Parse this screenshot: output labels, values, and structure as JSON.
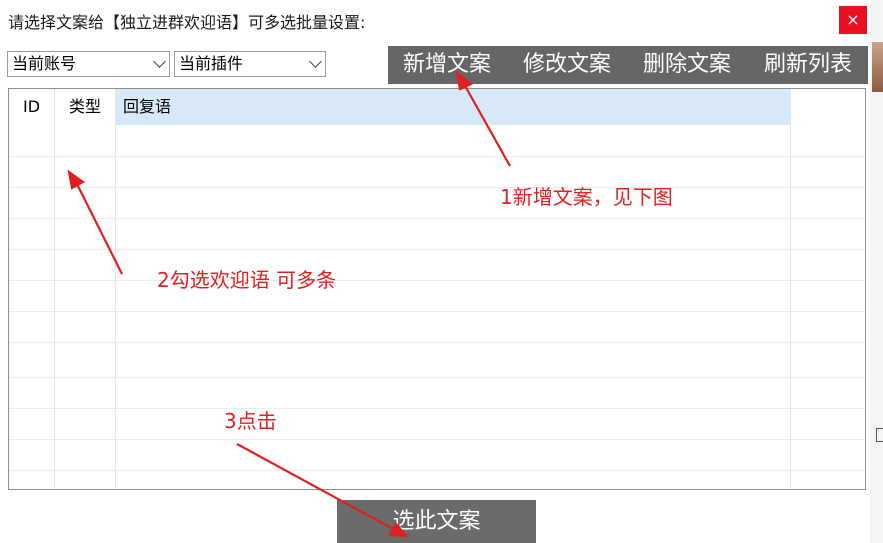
{
  "dialog": {
    "title": "请选择文案给【独立进群欢迎语】可多选批量设置:",
    "close_label": "×"
  },
  "filters": {
    "account": {
      "selected": "当前账号"
    },
    "plugin": {
      "selected": "当前插件"
    }
  },
  "toolbar": {
    "add_label": "新增文案",
    "edit_label": "修改文案",
    "delete_label": "删除文案",
    "refresh_label": "刷新列表"
  },
  "table": {
    "columns": [
      "ID",
      "类型",
      "回复语"
    ],
    "rows": []
  },
  "annotations": {
    "step1": "1新增文案，见下图",
    "step2": "2勾选欢迎语 可多条",
    "step3": "3点击"
  },
  "footer": {
    "select_label": "选此文案"
  },
  "colors": {
    "toolbar_bg": "#666666",
    "close_bg": "#e81123",
    "annotation": "#e02020",
    "header_selected": "#d7e9f8"
  }
}
